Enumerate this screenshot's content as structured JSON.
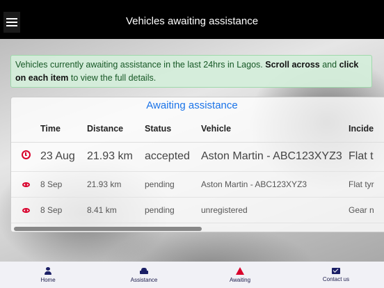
{
  "header": {
    "title": "Vehicles awaiting assistance",
    "menu_icon": "hamburger-icon"
  },
  "alert": {
    "text_1": "Vehicles currently awaiting assistance in the last 24hrs in Lagos.",
    "bold_1": "Scroll across",
    "text_2": "and",
    "bold_2": "click on each item",
    "text_3": "to view the full details."
  },
  "panel": {
    "title": "Awaiting assistance",
    "columns": [
      "Time",
      "Distance",
      "Status",
      "Vehicle",
      "Incide"
    ],
    "rows": [
      {
        "icon": "clock-icon",
        "time": "23 Aug",
        "distance": "21.93 km",
        "status": "accepted",
        "vehicle": "Aston Martin - ABC123XYZ3",
        "incident": "Flat t"
      },
      {
        "icon": "eye-icon",
        "time": "8 Sep",
        "distance": "21.93 km",
        "status": "pending",
        "vehicle": "Aston Martin - ABC123XYZ3",
        "incident": "Flat tyr"
      },
      {
        "icon": "eye-icon",
        "time": "8 Sep",
        "distance": "8.41 km",
        "status": "pending",
        "vehicle": "unregistered",
        "incident": "Gear n"
      }
    ]
  },
  "bottom_nav": [
    {
      "label": "Home",
      "icon": "user-icon"
    },
    {
      "label": "Assistance",
      "icon": "car-icon"
    },
    {
      "label": "Awaiting",
      "icon": "warning-icon"
    },
    {
      "label": "Contact us",
      "icon": "envelope-icon"
    }
  ],
  "colors": {
    "accent_red": "#d9002b",
    "nav_navy": "#1b1f66",
    "title_blue": "#1a73e8",
    "alert_green": "#d4edda"
  }
}
